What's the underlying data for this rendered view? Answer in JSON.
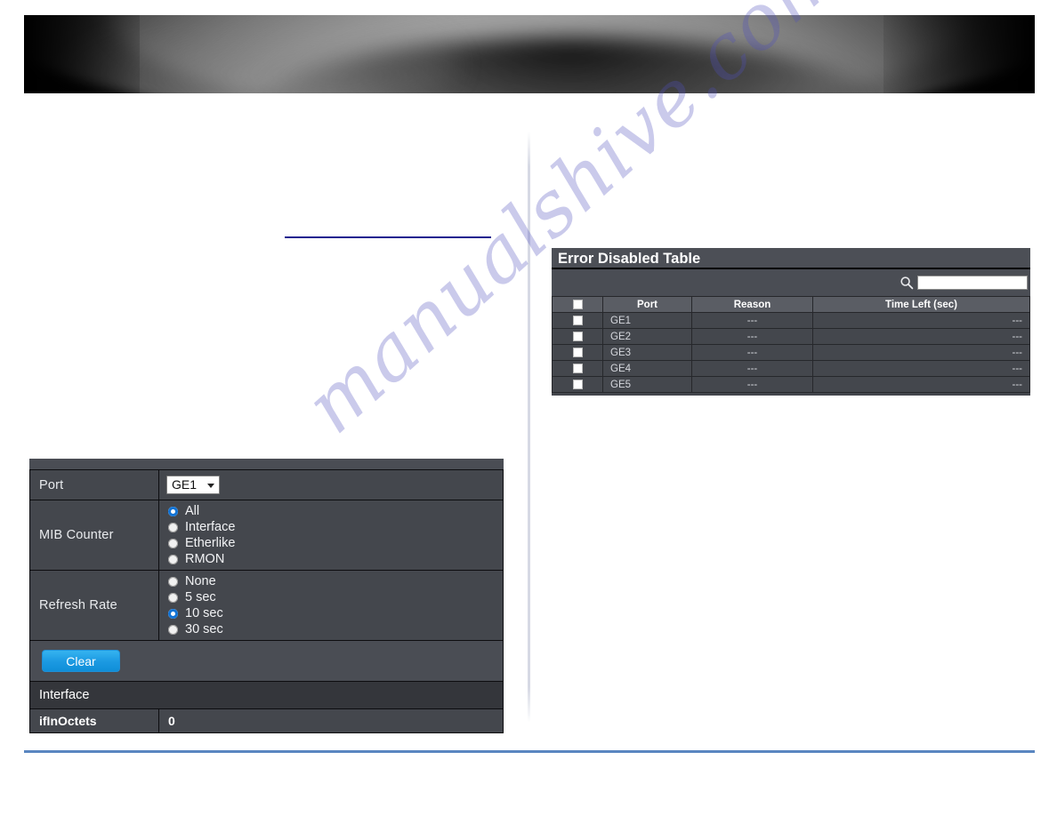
{
  "header": {
    "banner_name": "product-hero-banner",
    "background_color": "#050505"
  },
  "watermark": {
    "text": "manualshive.com",
    "color": "#4e4ebe"
  },
  "rules": {
    "title_rule_color": "#1b1b8f",
    "footer_rule_color": "#5a86c0"
  },
  "mib_form": {
    "rows": {
      "port": {
        "label": "Port",
        "selected": "GE1",
        "options": [
          "GE1"
        ]
      },
      "mib_counter": {
        "label": "MIB Counter",
        "options": [
          {
            "label": "All",
            "selected": true
          },
          {
            "label": "Interface",
            "selected": false
          },
          {
            "label": "Etherlike",
            "selected": false
          },
          {
            "label": "RMON",
            "selected": false
          }
        ]
      },
      "refresh_rate": {
        "label": "Refresh Rate",
        "options": [
          {
            "label": "None",
            "selected": false
          },
          {
            "label": "5 sec",
            "selected": false
          },
          {
            "label": "10 sec",
            "selected": true
          },
          {
            "label": "30 sec",
            "selected": false
          }
        ]
      }
    },
    "clear_button": "Clear",
    "section_header": "Interface",
    "counters": [
      {
        "name": "ifInOctets",
        "value": "0"
      }
    ]
  },
  "error_disabled_table": {
    "title": "Error Disabled Table",
    "search_placeholder": "",
    "search_value": "",
    "search_icon": "search-icon",
    "columns": [
      "",
      "Port",
      "Reason",
      "Time Left (sec)"
    ],
    "rows": [
      {
        "checked": false,
        "port": "GE1",
        "reason": "---",
        "time_left": "---"
      },
      {
        "checked": false,
        "port": "GE2",
        "reason": "---",
        "time_left": "---"
      },
      {
        "checked": false,
        "port": "GE3",
        "reason": "---",
        "time_left": "---"
      },
      {
        "checked": false,
        "port": "GE4",
        "reason": "---",
        "time_left": "---"
      },
      {
        "checked": false,
        "port": "GE5",
        "reason": "---",
        "time_left": "---"
      }
    ]
  }
}
